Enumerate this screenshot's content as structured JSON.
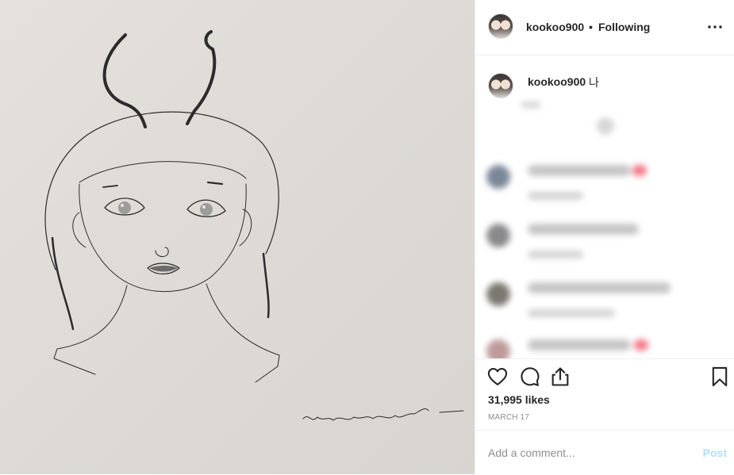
{
  "post": {
    "image_alt": "pencil drawing of a girl with antennae",
    "signature": "Kuhye sun jeu° 2019."
  },
  "header": {
    "username": "kookoo900",
    "separator": "•",
    "follow_status": "Following",
    "more_icon": "more-horizontal-icon"
  },
  "caption": {
    "username": "kookoo900",
    "text": "나"
  },
  "actions": {
    "icons": [
      "heart-icon",
      "comment-icon",
      "share-icon",
      "bookmark-icon"
    ],
    "likes": "31,995 likes",
    "date": "MARCH 17"
  },
  "comment_box": {
    "placeholder": "Add a comment...",
    "post_label": "Post",
    "post_color": "#b2dffc"
  }
}
